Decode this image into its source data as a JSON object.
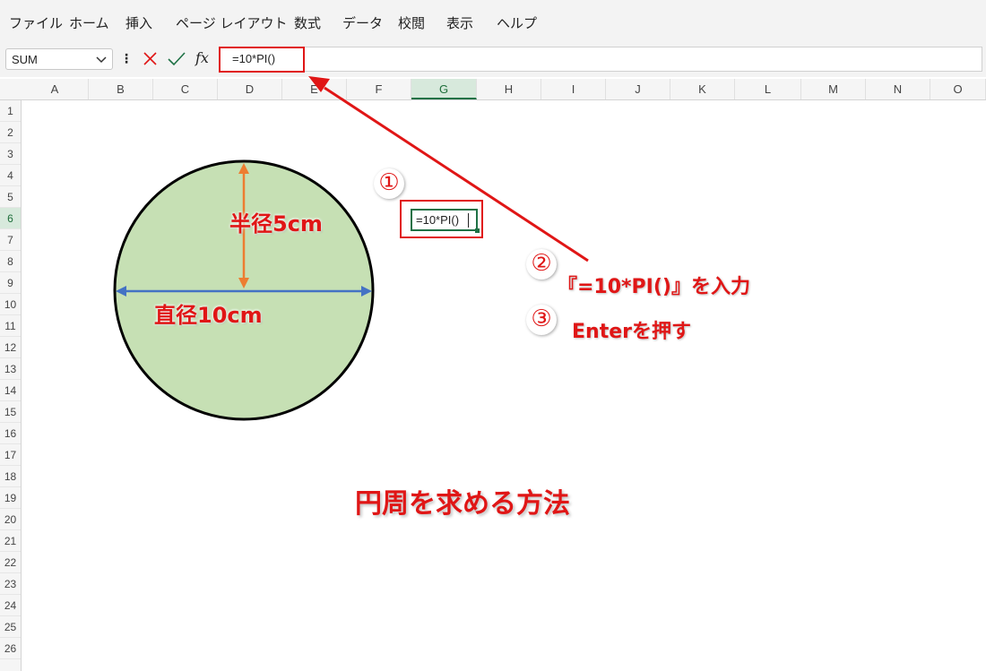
{
  "menu": {
    "items": [
      "ファイル",
      "ホーム",
      "挿入",
      "ページ レイアウト",
      "数式",
      "データ",
      "校閲",
      "表示",
      "ヘルプ"
    ]
  },
  "formula_bar": {
    "name_box": "SUM",
    "fx_label": "fx",
    "formula": "=10*PI()"
  },
  "grid": {
    "columns": [
      "A",
      "B",
      "C",
      "D",
      "E",
      "F",
      "G",
      "H",
      "I",
      "J",
      "K",
      "L",
      "M",
      "N",
      "O"
    ],
    "selected_column": "G",
    "rows": [
      "1",
      "2",
      "3",
      "4",
      "5",
      "6",
      "7",
      "8",
      "9",
      "10",
      "11",
      "12",
      "13",
      "14",
      "15",
      "16",
      "17",
      "18",
      "19",
      "20",
      "21",
      "22",
      "23",
      "24",
      "25",
      "26"
    ],
    "active_cell_value": "=10*PI()"
  },
  "annotations": {
    "step1_num": "①",
    "step2_num": "②",
    "step3_num": "③",
    "step2_text": "『=10*PI()』を入力",
    "step3_text": "Enterを押す",
    "radius_label": "半径5cm",
    "diameter_label": "直径10cm",
    "title": "円周を求める方法"
  },
  "colors": {
    "accent_red": "#e01616",
    "excel_green": "#1e7145",
    "circle_fill": "#c6e0b4",
    "radius_arrow": "#ed7d31",
    "diameter_arrow": "#4472c4"
  }
}
